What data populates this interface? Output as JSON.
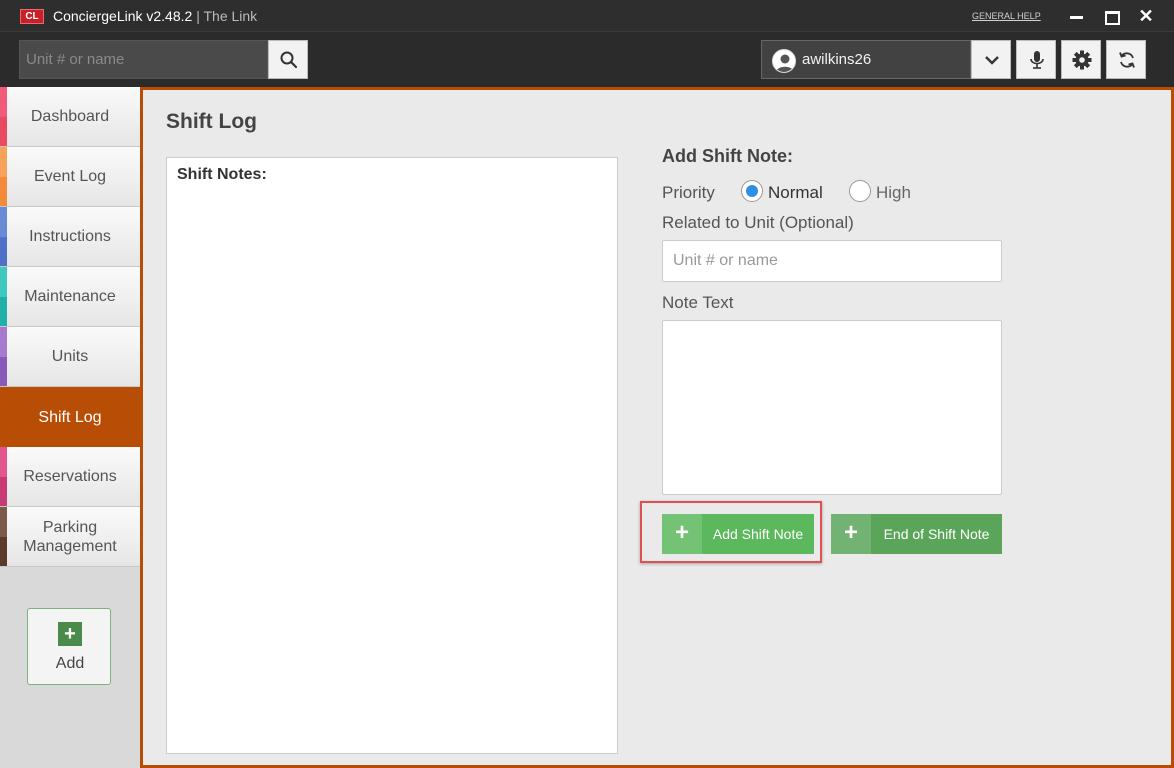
{
  "window": {
    "logo_text": "CL",
    "app_name": "ConciergeLink v2.48.2",
    "separator": "|",
    "app_subtitle": "The Link",
    "general_help": "GENERAL HELP",
    "close_glyph": "✕"
  },
  "toolbar": {
    "search_placeholder": "Unit # or name",
    "username": "awilkins26",
    "icons": [
      "search-icon",
      "user-avatar-icon",
      "chevron-down-icon",
      "microphone-icon",
      "gear-icon",
      "refresh-icon"
    ]
  },
  "sidebar": {
    "items": [
      {
        "label": "Dashboard",
        "colors": [
          "#f25a7a",
          "#e84a5f"
        ],
        "active": false
      },
      {
        "label": "Event Log",
        "colors": [
          "#f7a25a",
          "#f28a3a"
        ],
        "active": false
      },
      {
        "label": "Instructions",
        "colors": [
          "#6a8ad8",
          "#4f6fc8"
        ],
        "active": false
      },
      {
        "label": "Maintenance",
        "colors": [
          "#3fc8c0",
          "#20b0a8"
        ],
        "active": false
      },
      {
        "label": "Units",
        "colors": [
          "#a77ad0",
          "#8a5ab8"
        ],
        "active": false
      },
      {
        "label": "Shift Log",
        "colors": [
          "#b84d05",
          "#b84d05"
        ],
        "active": true
      },
      {
        "label": "Reservations",
        "colors": [
          "#e2568e",
          "#c83a74"
        ],
        "active": false
      },
      {
        "label": "Parking Management",
        "colors": [
          "#7a5a48",
          "#5a3a28"
        ],
        "active": false
      }
    ],
    "add_label": "Add",
    "add_plus": "+"
  },
  "main": {
    "title": "Shift Log",
    "notes_title": "Shift Notes:",
    "form": {
      "title": "Add Shift Note:",
      "priority_label": "Priority",
      "priority_options": [
        "Normal",
        "High"
      ],
      "priority_selected": "Normal",
      "unit_label": "Related to Unit (Optional)",
      "unit_placeholder": "Unit # or name",
      "note_label": "Note Text",
      "note_value": "",
      "add_button": "Add Shift Note",
      "end_button": "End of Shift Note",
      "plus": "+"
    }
  },
  "colors": {
    "accent": "#b84d05",
    "green": "#5cb85c",
    "radio_selected": "#2e8fe6",
    "highlight": "#e05050"
  }
}
